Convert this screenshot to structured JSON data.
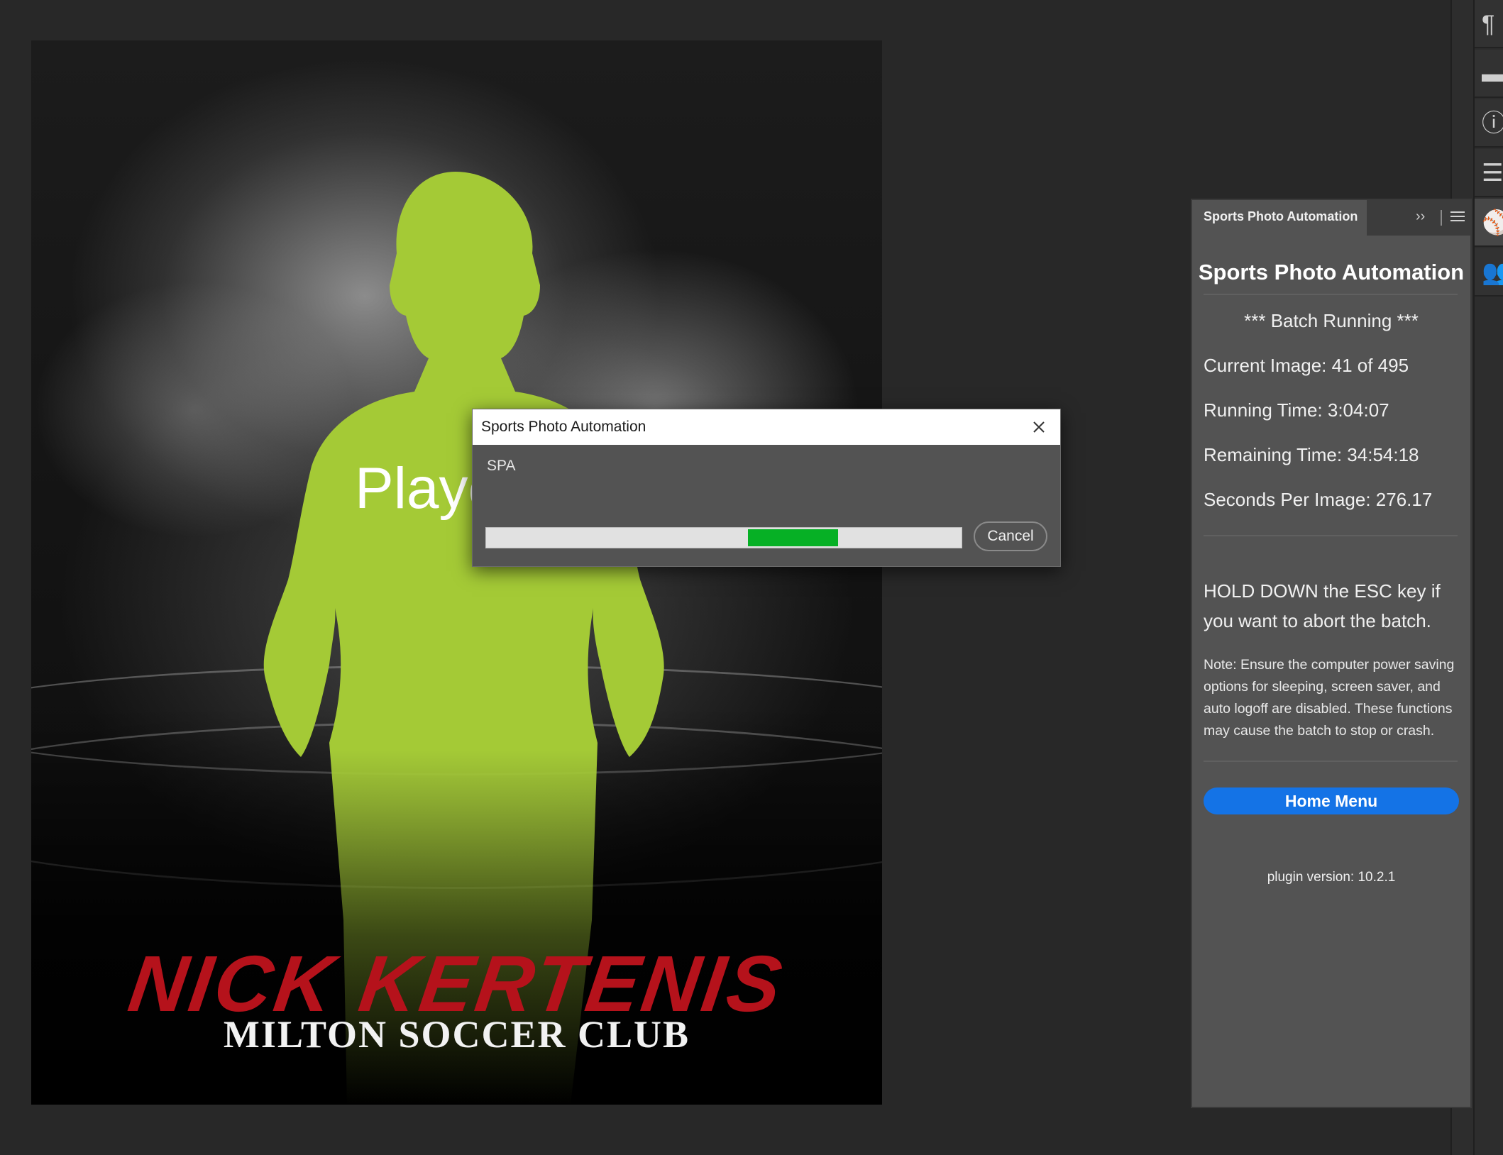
{
  "canvas": {
    "player_placeholder": "Player",
    "player_name": "NICK KERTENIS",
    "club_name": "MILTON SOCCER CLUB",
    "silhouette_color": "#a4ca36",
    "name_color": "#b5121b"
  },
  "panel": {
    "tab_label": "Sports Photo Automation",
    "collapse_glyph": "››",
    "heading": "Sports Photo Automation",
    "batch_status": "*** Batch Running ***",
    "current_image": "Current Image: 41 of 495",
    "running_time": "Running Time: 3:04:07",
    "remaining_time": "Remaining Time: 34:54:18",
    "seconds_per_image": "Seconds Per Image: 276.17",
    "esc_warning": "HOLD DOWN the ESC key if you want to abort the batch.",
    "power_note": "Note: Ensure the computer power saving options for sleeping, screen saver, and auto logoff are disabled. These functions may cause the batch to stop or crash.",
    "home_button": "Home Menu",
    "plugin_version": "plugin version: 10.2.1",
    "accent_color": "#1473e6"
  },
  "dialog": {
    "title": "Sports Photo Automation",
    "message": "SPA",
    "cancel_label": "Cancel",
    "progress_segment_start": 0.55,
    "progress_segment_end": 0.74,
    "progress_color": "#06b025"
  },
  "toolbar": {
    "icons": [
      "paragraph-icon",
      "layer-comps-icon",
      "info-icon",
      "properties-icon",
      "sports-ball-icon",
      "people-icon"
    ]
  }
}
